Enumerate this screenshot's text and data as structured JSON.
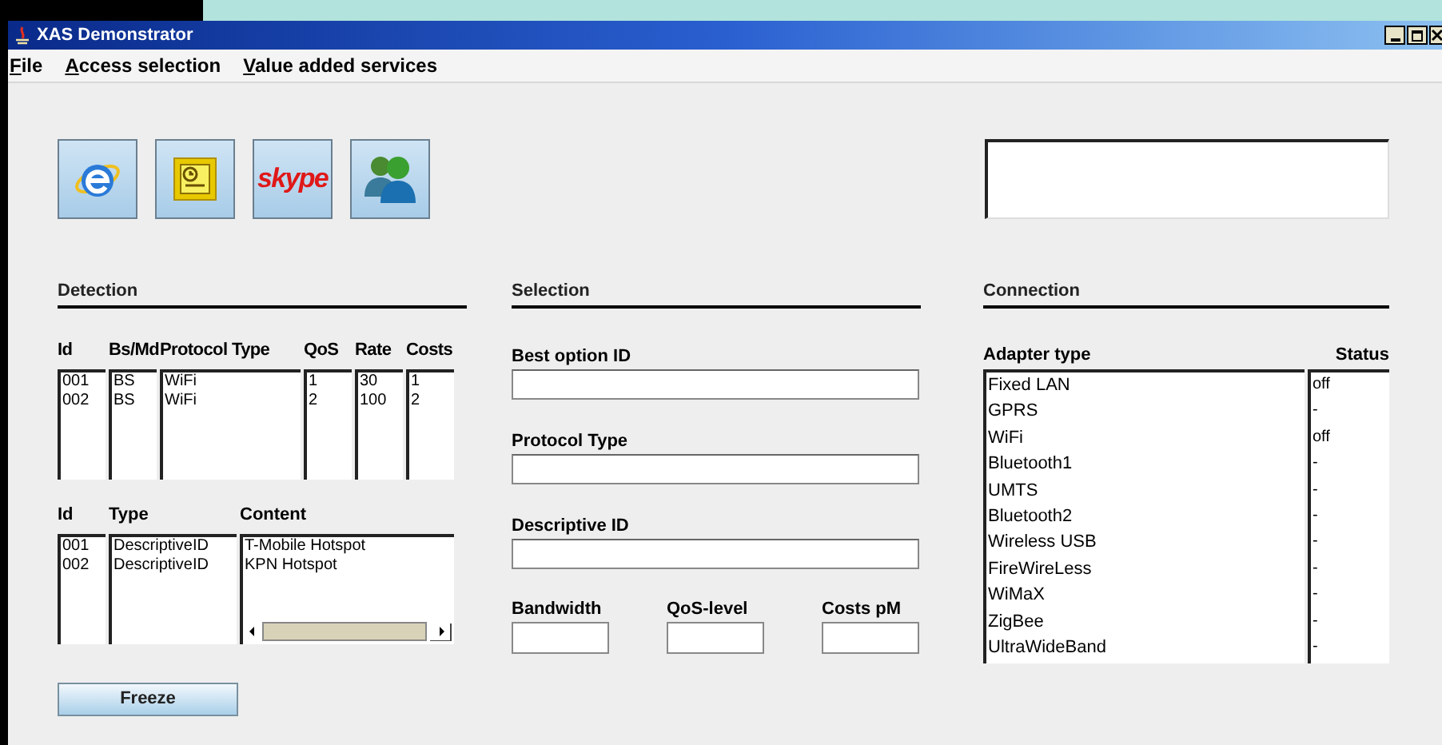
{
  "window": {
    "title": "XAS Demonstrator"
  },
  "menu": [
    "File",
    "Access selection",
    "Value added services"
  ],
  "toolbar": [
    {
      "kind": "browser"
    },
    {
      "kind": "clock"
    },
    {
      "kind": "skype",
      "label": "skype"
    },
    {
      "kind": "people"
    }
  ],
  "detection": {
    "title": "Detection",
    "columns": [
      "Id",
      "Bs/Md",
      "Protocol Type",
      "QoS",
      "Rate",
      "Costs"
    ],
    "rows": [
      [
        "001",
        "BS",
        "WiFi",
        "1",
        "30",
        "1"
      ],
      [
        "002",
        "BS",
        "WiFi",
        "2",
        "100",
        "2"
      ]
    ],
    "descriptors": {
      "columns": [
        "Id",
        "Type",
        "Content"
      ],
      "rows": [
        [
          "001",
          "DescriptiveID",
          "T-Mobile Hotspot"
        ],
        [
          "002",
          "DescriptiveID",
          "KPN Hotspot"
        ]
      ]
    },
    "button": "Freeze"
  },
  "selection": {
    "title": "Selection",
    "fields": [
      "Best option ID",
      "Protocol Type",
      "Descriptive ID"
    ],
    "small_fields": [
      "Bandwidth",
      "QoS-level",
      "Costs pM"
    ]
  },
  "connection": {
    "title": "Connection",
    "columns": [
      "Adapter type",
      "Status"
    ],
    "adapters": [
      {
        "name": "Fixed LAN",
        "status": "off"
      },
      {
        "name": "GPRS",
        "status": "-"
      },
      {
        "name": "WiFi",
        "status": "off"
      },
      {
        "name": "Bluetooth1",
        "status": "-"
      },
      {
        "name": "UMTS",
        "status": "-"
      },
      {
        "name": "Bluetooth2",
        "status": "-"
      },
      {
        "name": "Wireless USB",
        "status": "-"
      },
      {
        "name": "FireWireLess",
        "status": "-"
      },
      {
        "name": "WiMaX",
        "status": "-"
      },
      {
        "name": "ZigBee",
        "status": "-"
      },
      {
        "name": "UltraWideBand",
        "status": "-"
      }
    ]
  }
}
